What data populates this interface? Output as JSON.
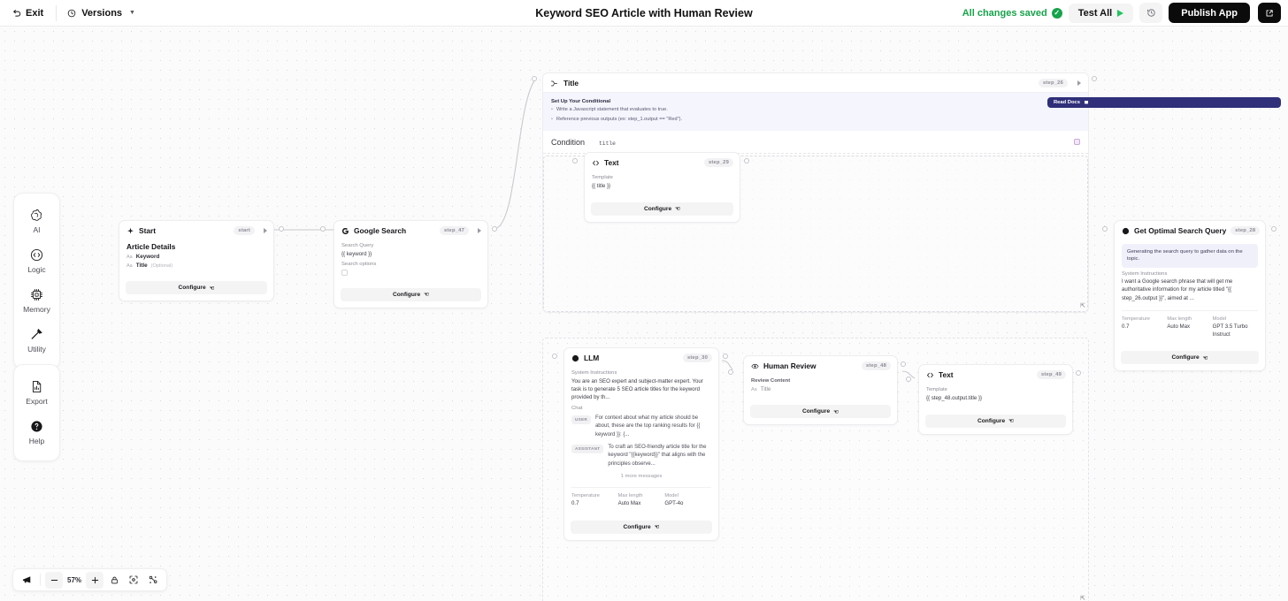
{
  "topbar": {
    "exit_label": "Exit",
    "versions_label": "Versions",
    "title": "Keyword SEO Article with Human Review",
    "saved_label": "All changes saved",
    "test_all_label": "Test All",
    "publish_label": "Publish App",
    "history_icon": "history-clock-icon",
    "share_icon": "external-link-icon",
    "saved_color": "#17a34a",
    "publish_bg": "#0b0b0b"
  },
  "palette": {
    "group1": [
      {
        "label": "AI",
        "icon": "ai-spiral-icon"
      },
      {
        "label": "Logic",
        "icon": "logic-circle-icon"
      },
      {
        "label": "Memory",
        "icon": "memory-chip-icon"
      },
      {
        "label": "Utility",
        "icon": "utility-hammer-icon"
      }
    ],
    "group2": [
      {
        "label": "Export",
        "icon": "export-document-icon"
      },
      {
        "label": "Help",
        "icon": "help-question-icon"
      }
    ]
  },
  "nodes": {
    "start": {
      "title": "Start",
      "badge": "start",
      "icon": "start-sparkle-icon",
      "heading": "Article Details",
      "inputs": [
        {
          "tag": "Aa",
          "name": "Keyword",
          "optional": ""
        },
        {
          "tag": "Aa",
          "name": "Title",
          "optional": "(Optional)"
        }
      ],
      "configure": "Configure"
    },
    "google_search": {
      "title": "Google Search",
      "badge": "step_47",
      "icon": "google-g-icon",
      "fields": [
        {
          "label": "Search Query",
          "value": "{{ keyword }}"
        },
        {
          "label": "Search options",
          "value": ""
        }
      ],
      "configure": "Configure"
    },
    "conditional": {
      "title": "Title",
      "badge": "step_26",
      "icon": "branch-icon",
      "hint_heading": "Set Up Your Conditional",
      "hint_items": [
        "Write a Javascript statement that evaluates to true.",
        "Reference previous outputs (ex: step_1.output == \"Red\")."
      ],
      "read_docs": "Read Docs",
      "condition_label": "Condition",
      "condition_value": "title"
    },
    "text_inner": {
      "title": "Text",
      "badge": "step_29",
      "icon": "text-code-icon",
      "template_label": "Template",
      "template_value": "{{ title }}",
      "configure": "Configure"
    },
    "optimal_query": {
      "title": "Get Optimal Search Query",
      "badge": "step_28",
      "icon": "openai-icon",
      "banner": "Generating the search query to gather data on the topic.",
      "system_label": "System Instructions",
      "system_value": "I want a Google search phrase that will get me authoritative information for my article titled \"{{ step_26.output }}\", aimed at ...",
      "params": [
        {
          "label": "Temperature",
          "value": "0.7"
        },
        {
          "label": "Max length",
          "value": "Auto Max"
        },
        {
          "label": "Model",
          "value": "GPT 3.5 Turbo Instruct"
        }
      ],
      "configure": "Configure"
    },
    "llm": {
      "title": "LLM",
      "badge": "step_30",
      "icon": "openai-icon",
      "system_label": "System Instructions",
      "system_value": "You are an SEO expert and subject-matter expert. Your task is to generate 5 SEO article titles for the keyword provided by th...",
      "chat_label": "Chat",
      "messages": [
        {
          "role": "USER",
          "text": "For context about what my article should be about, these are the top ranking results for {{ keyword }}: {..."
        },
        {
          "role": "ASSISTANT",
          "text": "To craft an SEO-friendly article title for the keyword \"{{keyword}}\" that aligns with the principles observe..."
        }
      ],
      "more_messages": "1 more messages",
      "params": [
        {
          "label": "Temperature",
          "value": "0.7"
        },
        {
          "label": "Max length",
          "value": "Auto Max"
        },
        {
          "label": "Model",
          "value": "GPT-4o"
        }
      ],
      "configure": "Configure"
    },
    "human_review": {
      "title": "Human Review",
      "badge": "step_48",
      "icon": "eye-icon",
      "field_label": "Review Content",
      "field_tag": "Aa",
      "field_value": "Title",
      "configure": "Configure"
    },
    "text_out": {
      "title": "Text",
      "badge": "step_49",
      "icon": "text-code-icon",
      "template_label": "Template",
      "template_value": "{{ step_48.output.title }}",
      "configure": "Configure"
    }
  },
  "zoombar": {
    "feedback_icon": "megaphone-icon",
    "zoom_out_icon": "minus-icon",
    "zoom_level": "57%",
    "zoom_in_icon": "plus-icon",
    "lock_icon": "lock-icon",
    "fit_icon": "fit-view-icon",
    "tidy_icon": "tidy-layout-icon"
  }
}
